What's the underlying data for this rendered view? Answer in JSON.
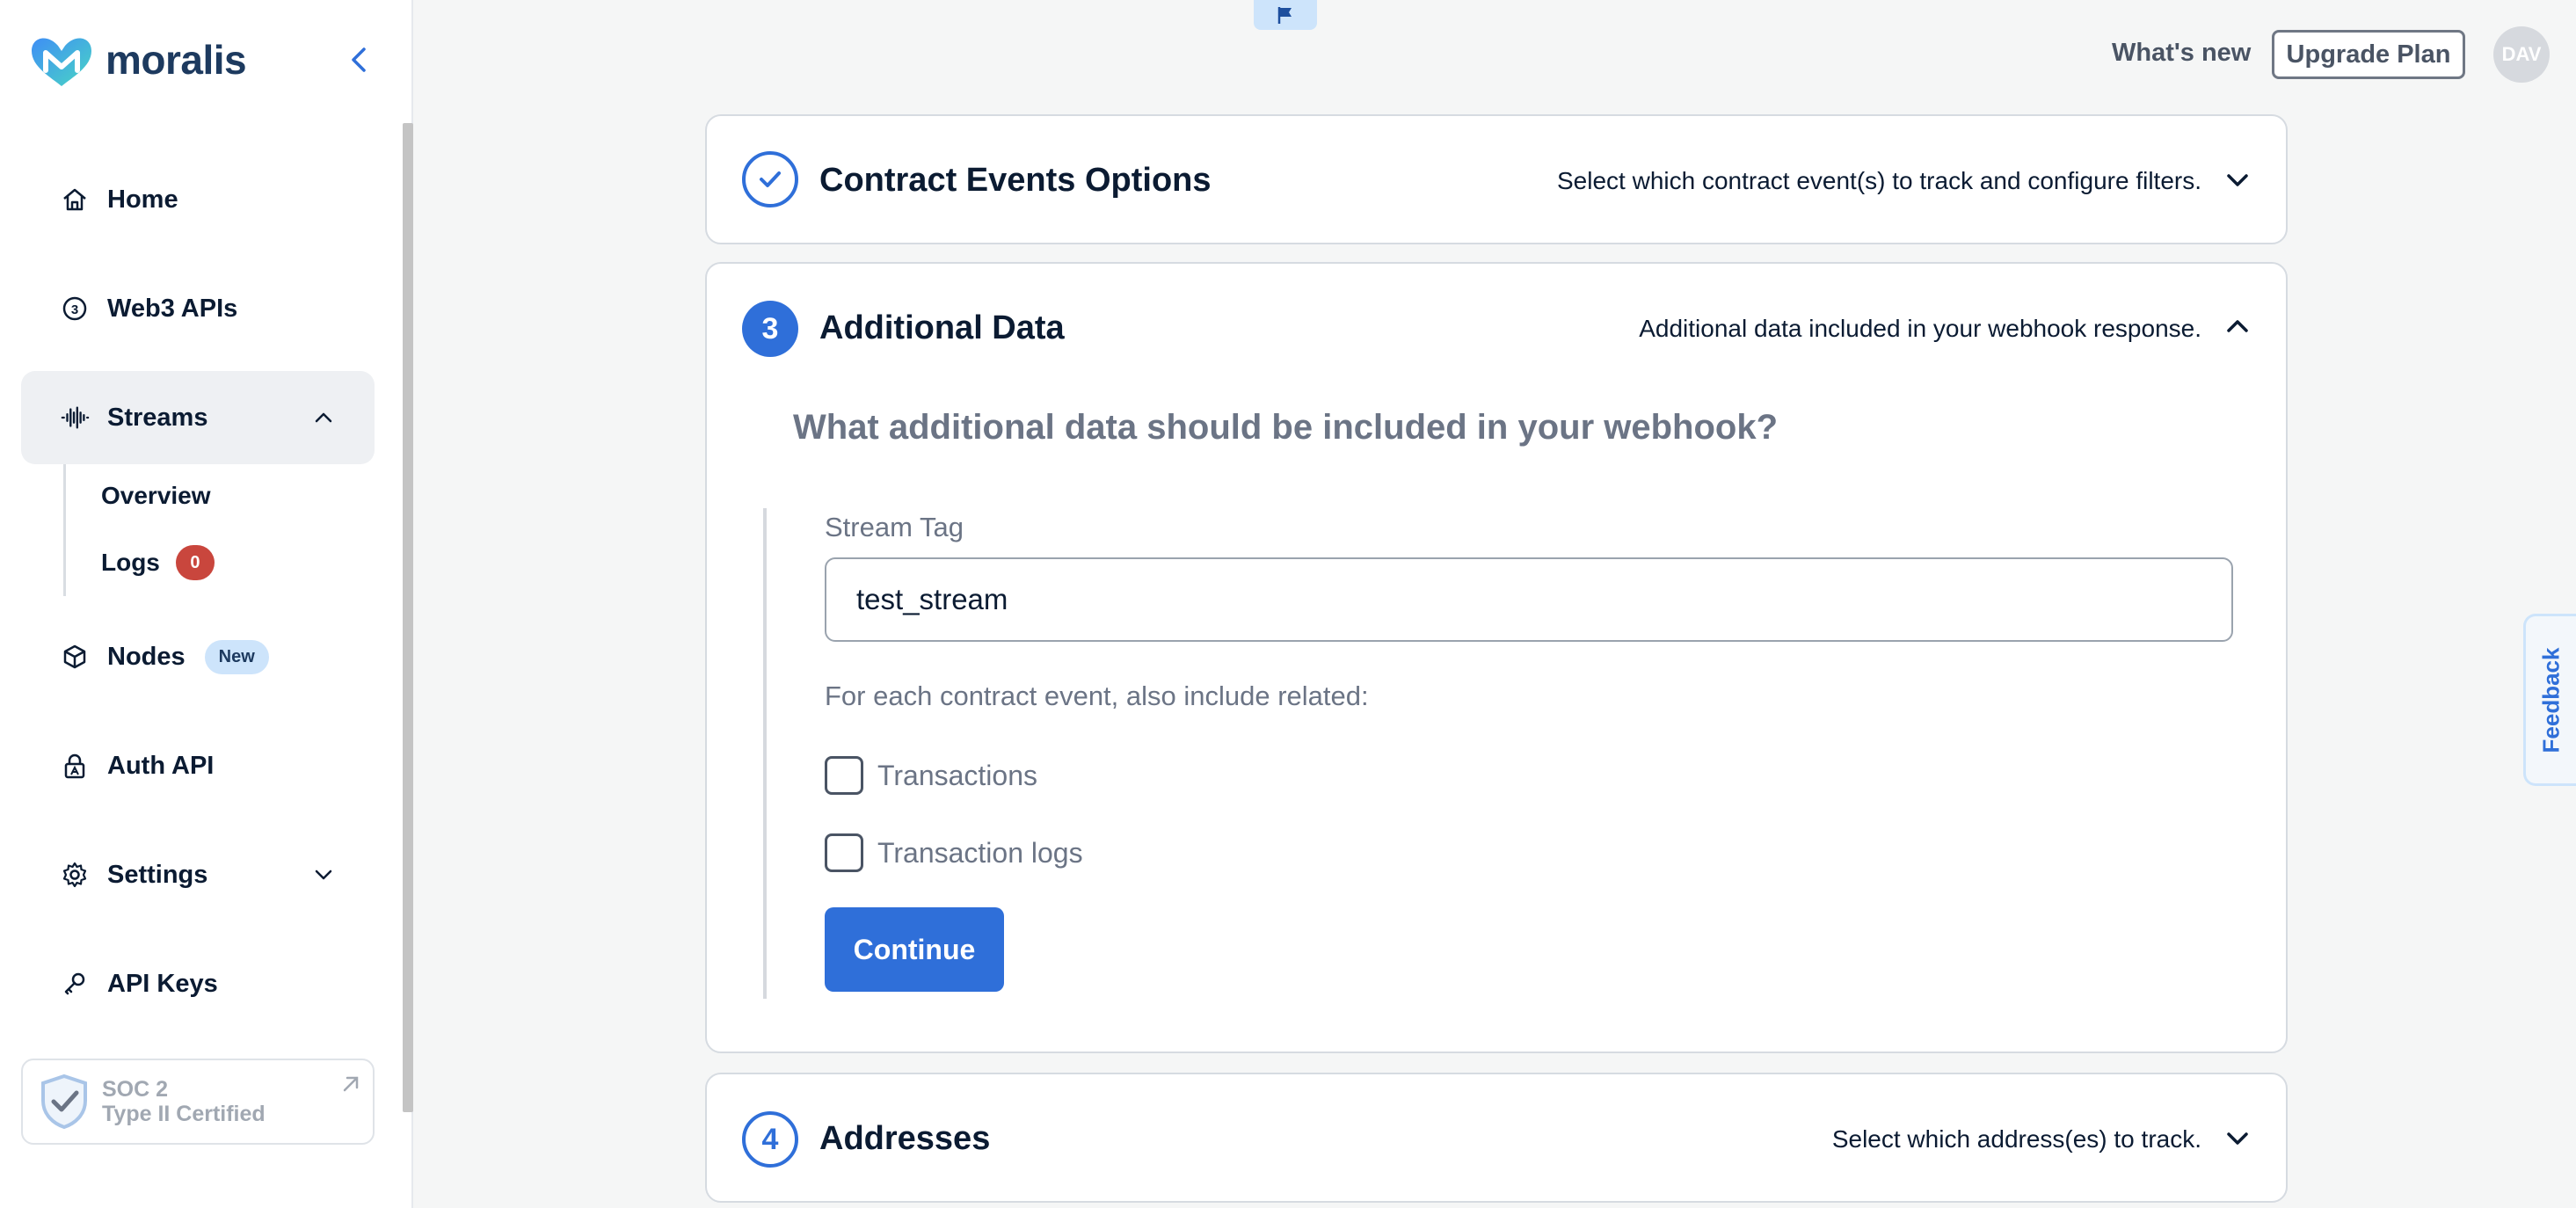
{
  "brand": {
    "name": "moralis"
  },
  "sidebar": {
    "items": [
      {
        "label": "Home",
        "icon": "home-icon"
      },
      {
        "label": "Web3 APIs",
        "icon": "web3-coin-icon"
      },
      {
        "label": "Streams",
        "icon": "waveform-icon"
      },
      {
        "label": "Nodes",
        "icon": "cube-icon",
        "badge": "New"
      },
      {
        "label": "Auth API",
        "icon": "lock-icon"
      },
      {
        "label": "Settings",
        "icon": "gear-icon"
      },
      {
        "label": "API Keys",
        "icon": "key-icon"
      }
    ],
    "streams_sub": [
      {
        "label": "Overview"
      },
      {
        "label": "Logs",
        "count": "0"
      }
    ],
    "soc": {
      "line1": "SOC 2",
      "line2": "Type II Certified"
    }
  },
  "topbar": {
    "whats_new": "What's new",
    "upgrade": "Upgrade Plan",
    "avatar": "DAV"
  },
  "steps": [
    {
      "title": "Contract Events Options",
      "description": "Select which contract event(s) to track and configure filters.",
      "state": "complete"
    },
    {
      "number": "3",
      "title": "Additional Data",
      "description": "Additional data included in your webhook response.",
      "state": "active"
    },
    {
      "number": "4",
      "title": "Addresses",
      "description": "Select which address(es) to track.",
      "state": "pending"
    }
  ],
  "additional_data": {
    "question": "What additional data should be included in your webhook?",
    "stream_tag_label": "Stream Tag",
    "stream_tag_value": "test_stream",
    "include_label": "For each contract event, also include related:",
    "options": [
      {
        "label": "Transactions",
        "checked": false
      },
      {
        "label": "Transaction logs",
        "checked": false
      }
    ],
    "continue": "Continue"
  },
  "feedback": "Feedback",
  "colors": {
    "accent": "#2f6fd9",
    "badge_red": "#c9463d",
    "badge_blue": "#cde4fb"
  }
}
